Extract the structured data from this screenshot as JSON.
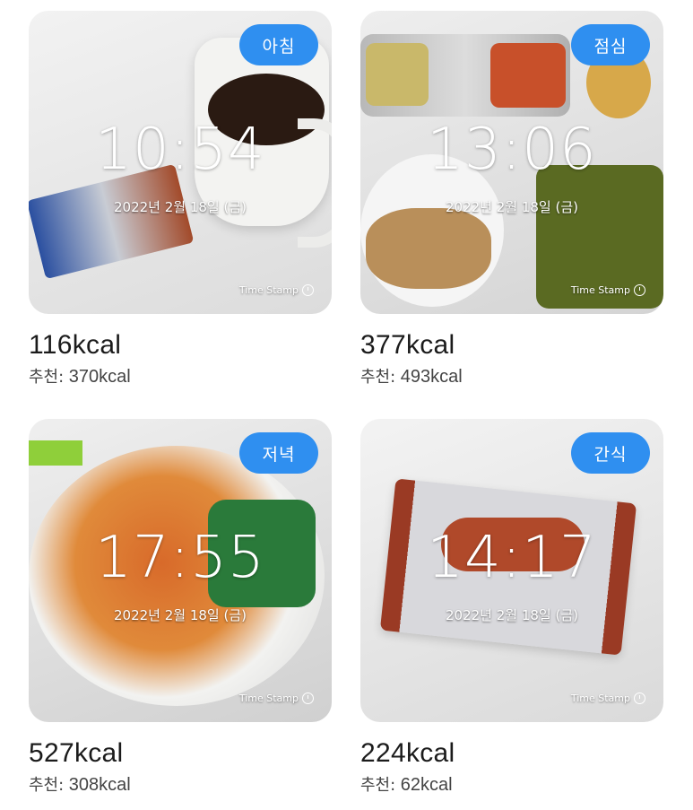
{
  "cards": [
    {
      "meal": "아침",
      "time": "10:54",
      "date": "2022년 2월 18일 (금)",
      "watermark": "Time Stamp",
      "kcal": "116kcal",
      "rec_label": "추천:",
      "rec_value": "370kcal"
    },
    {
      "meal": "점심",
      "time": "13:06",
      "date": "2022년 2월 18일 (금)",
      "watermark": "Time Stamp",
      "kcal": "377kcal",
      "rec_label": "추천:",
      "rec_value": "493kcal"
    },
    {
      "meal": "저녁",
      "time": "17:55",
      "date": "2022년 2월 18일 (금)",
      "watermark": "Time Stamp",
      "kcal": "527kcal",
      "rec_label": "추천:",
      "rec_value": "308kcal"
    },
    {
      "meal": "간식",
      "time": "14:17",
      "date": "2022년 2월 18일 (금)",
      "watermark": "Time Stamp",
      "kcal": "224kcal",
      "rec_label": "추천:",
      "rec_value": "62kcal"
    }
  ],
  "colors": {
    "badge": "#2f8ff0"
  },
  "icons": {
    "watermark": "clock-icon"
  }
}
